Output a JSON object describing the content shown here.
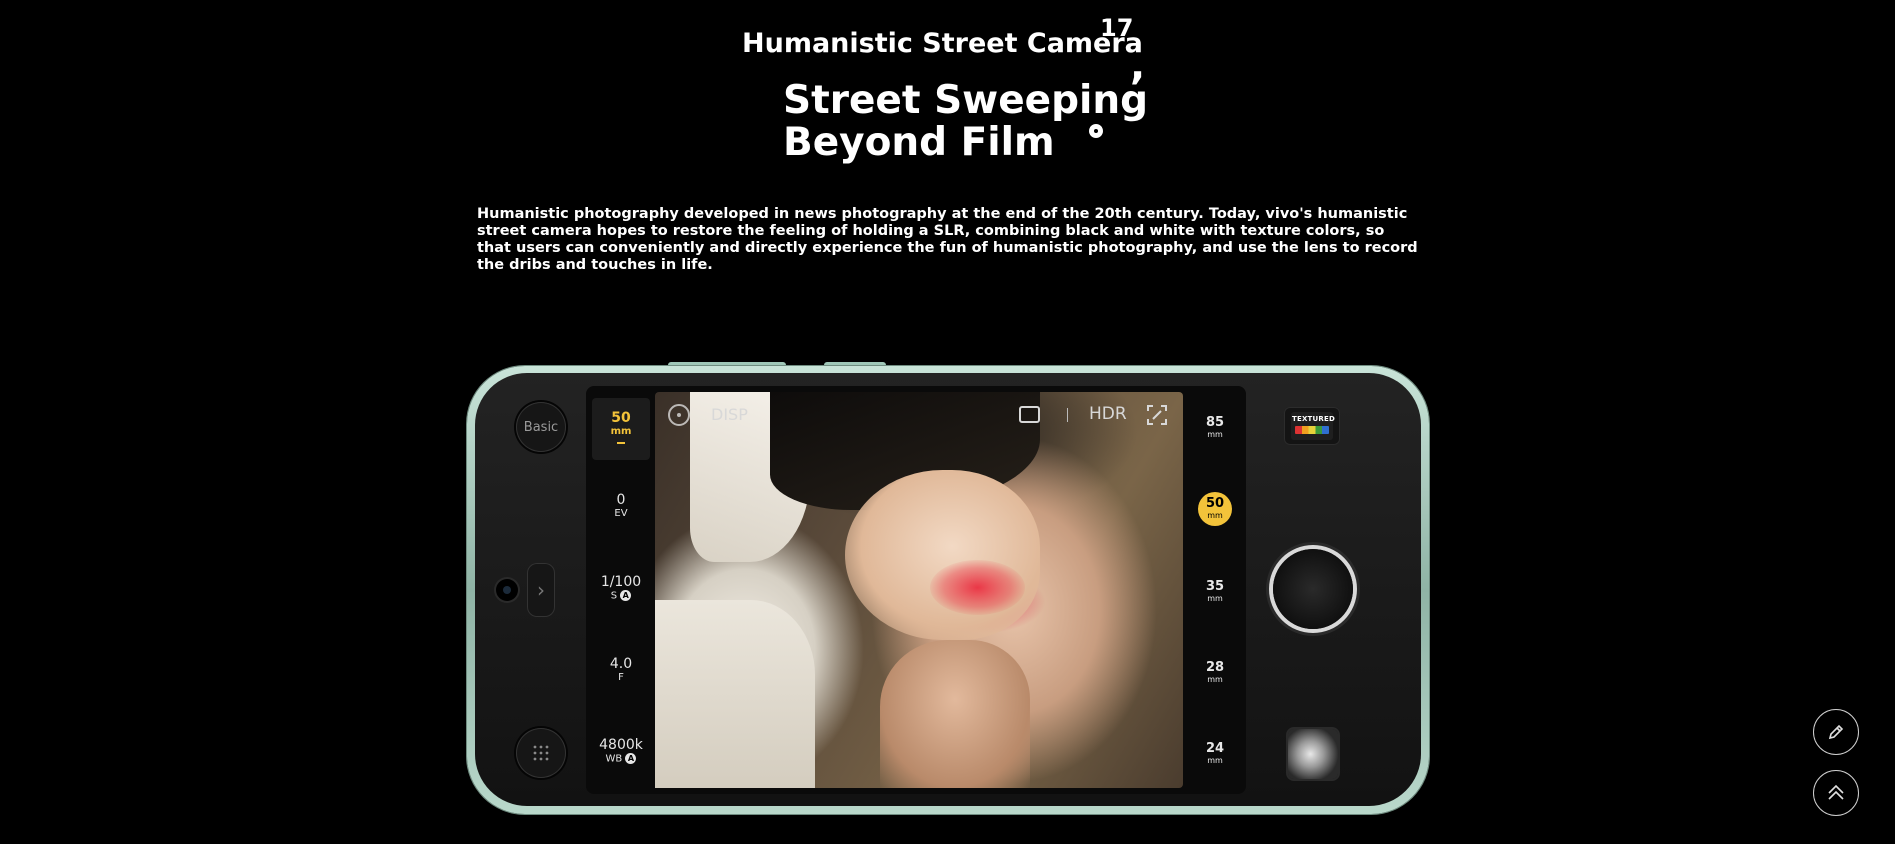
{
  "header": {
    "kicker": "Humanistic Street Camera",
    "superscript": "17",
    "headline": [
      "Street Sweeping",
      "Beyond Film"
    ],
    "intro": "Humanistic photography developed in news photography at the end of the 20th century. Today, vivo's humanistic street camera hopes to restore the feeling of holding a SLR, combining black and white with texture colors, so that users can conveniently and directly experience the fun of humanistic photography, and use the lens to record the dribs and touches in life."
  },
  "camera": {
    "mode_button": "Basic",
    "settings": [
      {
        "value": "50",
        "unit": "mm"
      },
      {
        "value": "0",
        "unit": "EV"
      },
      {
        "value": "1/100",
        "unit": "S"
      },
      {
        "value": "4.0",
        "unit": "F"
      },
      {
        "value": "4800k",
        "unit": "WB"
      }
    ],
    "auto_badge": "A",
    "topbar": {
      "disp": "DISP",
      "hdr": "HDR"
    },
    "focal_lengths": [
      {
        "value": "85",
        "unit": "mm"
      },
      {
        "value": "50",
        "unit": "mm",
        "selected": true
      },
      {
        "value": "35",
        "unit": "mm"
      },
      {
        "value": "28",
        "unit": "mm"
      },
      {
        "value": "24",
        "unit": "mm"
      }
    ],
    "filter_badge": "TEXTURED",
    "accent_color": "#f3c33a"
  },
  "icons": [
    "info-icon",
    "frame-icon",
    "focus-icon",
    "grid-icon",
    "chevron-right-icon",
    "edit-icon",
    "chevron-up-icon"
  ]
}
